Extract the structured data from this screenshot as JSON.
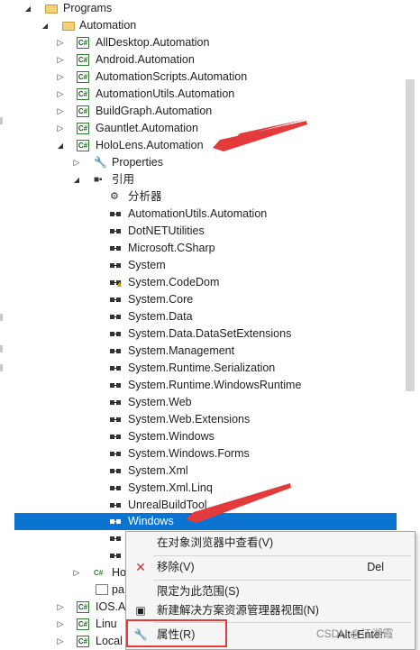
{
  "tree": {
    "rows": [
      {
        "label": "Programs",
        "icon": "folder-icon",
        "expander": "expanded"
      },
      {
        "label": "Automation",
        "icon": "folder-icon",
        "expander": "expanded"
      },
      {
        "label": "AllDesktop.Automation",
        "icon": "csharp-project-icon",
        "expander": "collapsed"
      },
      {
        "label": "Android.Automation",
        "icon": "csharp-project-icon",
        "expander": "collapsed"
      },
      {
        "label": "AutomationScripts.Automation",
        "icon": "csharp-project-icon",
        "expander": "collapsed"
      },
      {
        "label": "AutomationUtils.Automation",
        "icon": "csharp-project-icon",
        "expander": "collapsed"
      },
      {
        "label": "BuildGraph.Automation",
        "icon": "csharp-project-icon",
        "expander": "collapsed"
      },
      {
        "label": "Gauntlet.Automation",
        "icon": "csharp-project-icon",
        "expander": "collapsed"
      },
      {
        "label": "HoloLens.Automation",
        "icon": "csharp-project-icon",
        "expander": "expanded"
      },
      {
        "label": "Properties",
        "icon": "wrench-icon",
        "expander": "collapsed"
      },
      {
        "label": "引用",
        "icon": "references-icon",
        "expander": "expanded"
      },
      {
        "label": "分析器",
        "icon": "analyzer-icon",
        "expander": ""
      },
      {
        "label": "AutomationUtils.Automation",
        "icon": "reference-icon",
        "expander": ""
      },
      {
        "label": "DotNETUtilities",
        "icon": "reference-icon",
        "expander": ""
      },
      {
        "label": "Microsoft.CSharp",
        "icon": "reference-icon",
        "expander": ""
      },
      {
        "label": "System",
        "icon": "reference-icon",
        "expander": ""
      },
      {
        "label": "System.CodeDom",
        "icon": "reference-warning-icon",
        "expander": ""
      },
      {
        "label": "System.Core",
        "icon": "reference-icon",
        "expander": ""
      },
      {
        "label": "System.Data",
        "icon": "reference-icon",
        "expander": ""
      },
      {
        "label": "System.Data.DataSetExtensions",
        "icon": "reference-icon",
        "expander": ""
      },
      {
        "label": "System.Management",
        "icon": "reference-icon",
        "expander": ""
      },
      {
        "label": "System.Runtime.Serialization",
        "icon": "reference-icon",
        "expander": ""
      },
      {
        "label": "System.Runtime.WindowsRuntime",
        "icon": "reference-icon",
        "expander": ""
      },
      {
        "label": "System.Web",
        "icon": "reference-icon",
        "expander": ""
      },
      {
        "label": "System.Web.Extensions",
        "icon": "reference-icon",
        "expander": ""
      },
      {
        "label": "System.Windows",
        "icon": "reference-icon",
        "expander": ""
      },
      {
        "label": "System.Windows.Forms",
        "icon": "reference-icon",
        "expander": ""
      },
      {
        "label": "System.Xml",
        "icon": "reference-icon",
        "expander": ""
      },
      {
        "label": "System.Xml.Linq",
        "icon": "reference-icon",
        "expander": ""
      },
      {
        "label": "UnrealBuildTool",
        "icon": "reference-icon",
        "expander": ""
      },
      {
        "label": "Windows",
        "icon": "reference-icon",
        "expander": "",
        "selected": true
      },
      {
        "label": "",
        "icon": "reference-icon",
        "expander": ""
      },
      {
        "label": "",
        "icon": "reference-icon",
        "expander": ""
      },
      {
        "label": "Ho",
        "icon": "csharp-file-icon",
        "expander": "collapsed"
      },
      {
        "label": "pa",
        "icon": "file-icon",
        "expander": ""
      },
      {
        "label": "IOS.A",
        "icon": "csharp-project-icon",
        "expander": "collapsed"
      },
      {
        "label": "Linu",
        "icon": "csharp-project-icon",
        "expander": "collapsed"
      },
      {
        "label": "Local",
        "icon": "csharp-project-icon",
        "expander": "collapsed"
      }
    ]
  },
  "context_menu": {
    "items": [
      {
        "label": "在对象浏览器中查看(V)",
        "shortcut": "",
        "icon": ""
      },
      {
        "label": "移除(V)",
        "shortcut": "Del",
        "icon": "remove-x-icon"
      },
      {
        "label": "限定为此范围(S)",
        "shortcut": "",
        "icon": ""
      },
      {
        "label": "新建解决方案资源管理器视图(N)",
        "shortcut": "",
        "icon": "new-view-icon"
      },
      {
        "label": "属性(R)",
        "shortcut": "Alt+Enter",
        "icon": "wrench-icon"
      }
    ]
  },
  "watermark": "CSDN @江湖霞",
  "colors": {
    "selection": "#0b74d1",
    "annotation": "#e33b3b"
  }
}
